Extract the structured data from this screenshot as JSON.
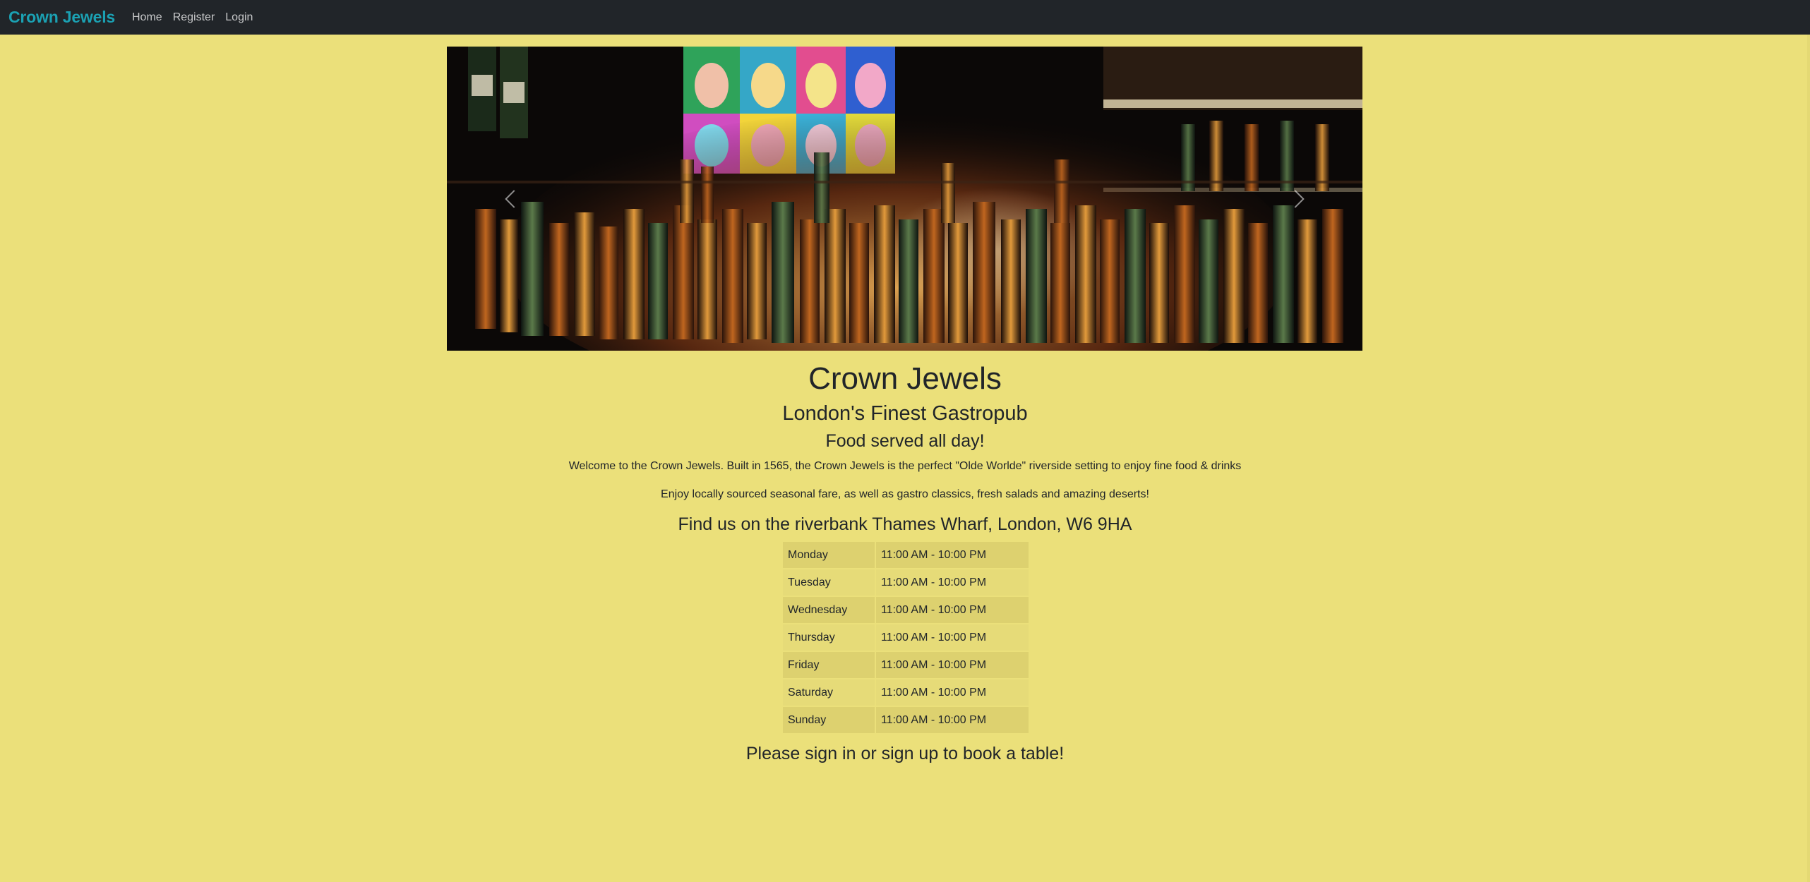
{
  "nav": {
    "brand": "Crown Jewels",
    "links": [
      "Home",
      "Register",
      "Login"
    ]
  },
  "carousel": {
    "image": "bar-shelves-with-bottles-photo",
    "prev_icon": "chevron-left-icon",
    "next_icon": "chevron-right-icon"
  },
  "main": {
    "title": "Crown Jewels",
    "subtitle": "London's Finest Gastropub",
    "food_line": "Food served all day!",
    "welcome": "Welcome to the Crown Jewels. Built in 1565, the Crown Jewels is the perfect \"Olde Worlde\" riverside setting to enjoy fine food & drinks",
    "enjoy": "Enjoy locally sourced seasonal fare, as well as gastro classics, fresh salads and amazing deserts!",
    "find_us": "Find us on the riverbank Thames Wharf, London, W6 9HA",
    "sign_in": "Please sign in or sign up to book a table!"
  },
  "hours": [
    {
      "day": "Monday",
      "time": "11:00 AM - 10:00 PM"
    },
    {
      "day": "Tuesday",
      "time": "11:00 AM - 10:00 PM"
    },
    {
      "day": "Wednesday",
      "time": "11:00 AM - 10:00 PM"
    },
    {
      "day": "Thursday",
      "time": "11:00 AM - 10:00 PM"
    },
    {
      "day": "Friday",
      "time": "11:00 AM - 10:00 PM"
    },
    {
      "day": "Saturday",
      "time": "11:00 AM - 10:00 PM"
    },
    {
      "day": "Sunday",
      "time": "11:00 AM - 10:00 PM"
    }
  ],
  "colors": {
    "background": "#ebe07a",
    "navbar": "#212529",
    "brand": "#1ba1b3",
    "nav_link": "#c8c9ca",
    "table_odd": "#ddd16f",
    "table_even": "#e6db78"
  }
}
